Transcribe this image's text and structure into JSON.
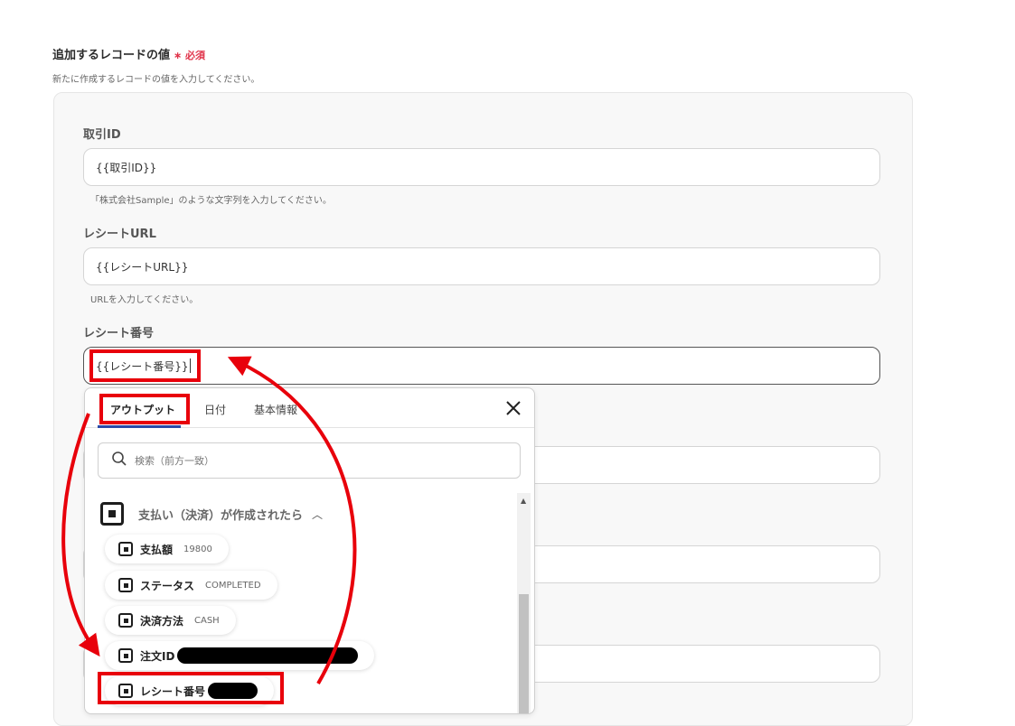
{
  "section": {
    "title": "追加するレコードの値",
    "required_mark": "∗ 必須",
    "description": "新たに作成するレコードの値を入力してください。"
  },
  "fields": [
    {
      "label": "取引ID",
      "value": "{{取引ID}}",
      "hint": "「株式会社Sample」のような文字列を入力してください。"
    },
    {
      "label": "レシートURL",
      "value": "{{レシートURL}}",
      "hint": "URLを入力してください。"
    },
    {
      "label": "レシート番号",
      "value": "{{レシート番号}}"
    }
  ],
  "dropdown": {
    "tabs": [
      "アウトプット",
      "日付",
      "基本情報"
    ],
    "active_tab": "アウトプット",
    "search_placeholder": "検索（前方一致）",
    "group_label": "支払い（決済）が作成されたら",
    "items": [
      {
        "name": "支払額",
        "value": "19800"
      },
      {
        "name": "ステータス",
        "value": "COMPLETED"
      },
      {
        "name": "決済方法",
        "value": "CASH"
      },
      {
        "name": "注文ID",
        "value": ""
      },
      {
        "name": "レシート番号",
        "value": ""
      }
    ]
  },
  "annotation_color": "#e8000b",
  "accent_color": "#2a4aa8",
  "required_color": "#e0344a"
}
